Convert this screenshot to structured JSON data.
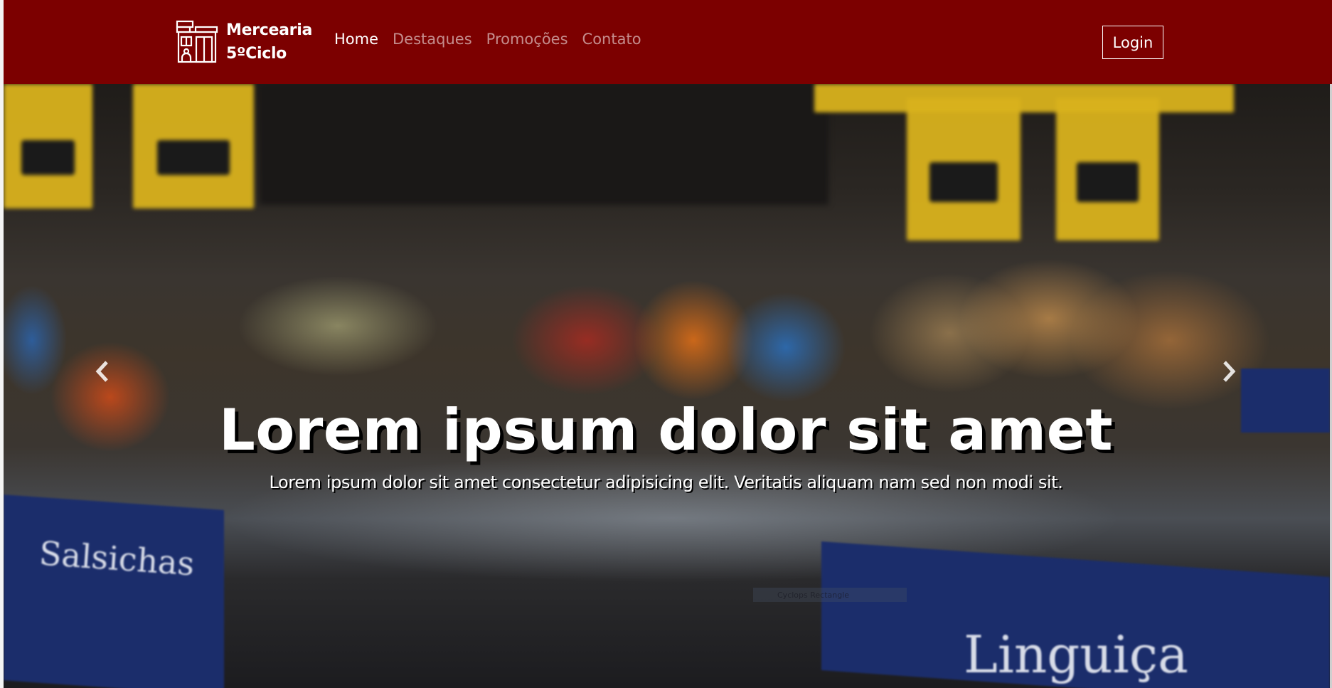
{
  "navbar": {
    "brand_line1": "Mercearia",
    "brand_line2": "5ºCiclo",
    "items": [
      {
        "label": "Home",
        "active": true
      },
      {
        "label": "Destaques",
        "active": false
      },
      {
        "label": "Promoções",
        "active": false
      },
      {
        "label": "Contato",
        "active": false
      }
    ],
    "login_label": "Login",
    "background_color": "#7c0000",
    "logo_icon": "store-icon"
  },
  "hero": {
    "title": "Lorem ipsum dolor sit amet",
    "subtitle": "Lorem ipsum dolor sit amet consectetur adipisicing elit. Veritatis aliquam nam sed non modi sit.",
    "prev_icon": "chevron-left-icon",
    "next_icon": "chevron-right-icon",
    "overlay_label": "Cyclops Rectangle",
    "placards": [
      "Salsichas",
      "Linguiça"
    ]
  }
}
